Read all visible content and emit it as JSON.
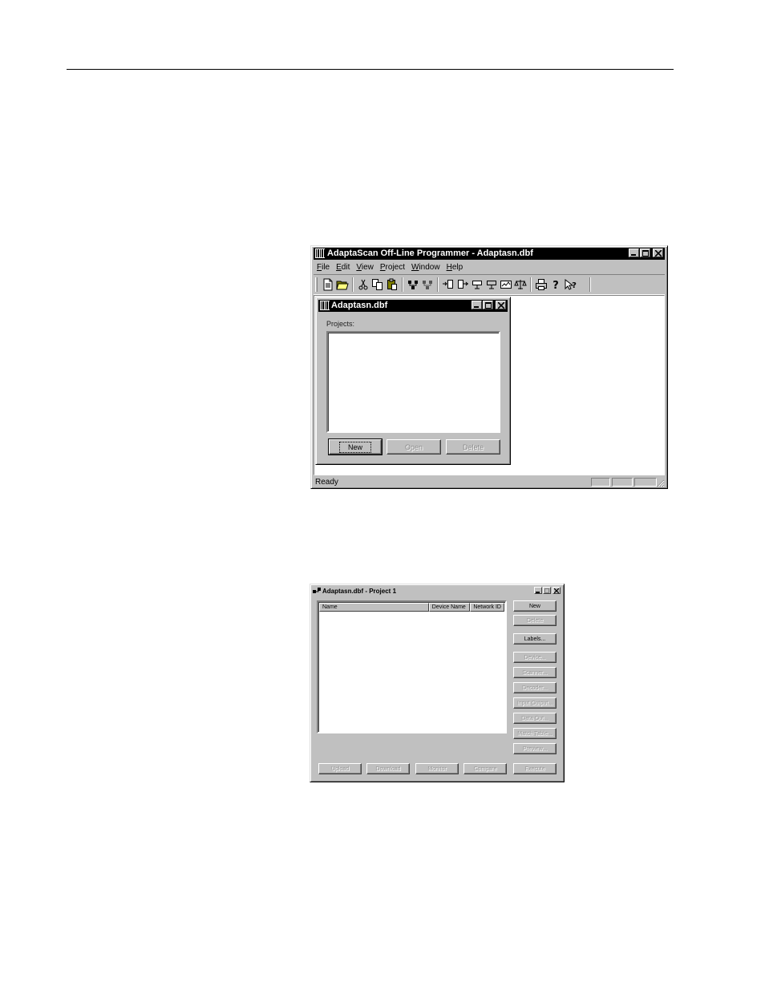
{
  "main_window": {
    "title": "AdaptaScan Off-Line Programmer - Adaptasn.dbf",
    "menu": [
      {
        "label": "File",
        "accel": "F",
        "rest": "ile"
      },
      {
        "label": "Edit",
        "accel": "E",
        "rest": "dit"
      },
      {
        "label": "View",
        "accel": "V",
        "rest": "iew"
      },
      {
        "label": "Project",
        "accel": "P",
        "rest": "roject"
      },
      {
        "label": "Window",
        "accel": "W",
        "rest": "indow"
      },
      {
        "label": "Help",
        "accel": "H",
        "rest": "elp"
      }
    ],
    "toolbar_icons": [
      "new-file-icon",
      "open-folder-icon",
      "cut-icon",
      "copy-icon",
      "paste-icon",
      "network-icon",
      "network-config-icon",
      "download-icon",
      "upload-icon",
      "device-icon",
      "device2-icon",
      "monitor-icon",
      "compare-icon",
      "print-icon",
      "help-icon",
      "context-help-icon"
    ],
    "status": "Ready"
  },
  "child_window": {
    "title": "Adaptasn.dbf",
    "projects_label": "Projects:",
    "buttons": {
      "new": "New",
      "open": "Open",
      "delete": "Delete"
    }
  },
  "project_dialog": {
    "title": "Adaptasn.dbf - Project 1",
    "columns": [
      "Name",
      "Device Name",
      "Network ID"
    ],
    "side_buttons": [
      {
        "label": "New",
        "enabled": true
      },
      {
        "label": "Delete",
        "enabled": false
      },
      {
        "label": "Labels...",
        "enabled": true
      },
      {
        "label": "Device...",
        "enabled": false
      },
      {
        "label": "Scanner...",
        "enabled": false
      },
      {
        "label": "Decoder...",
        "enabled": false
      },
      {
        "label": "Input Output...",
        "enabled": false
      },
      {
        "label": "Data Out...",
        "enabled": false
      },
      {
        "label": "Match Table...",
        "enabled": false
      },
      {
        "label": "Preview...",
        "enabled": false
      }
    ],
    "bottom_buttons": [
      {
        "label": "Upload",
        "enabled": false
      },
      {
        "label": "Download",
        "enabled": false
      },
      {
        "label": "Monitor",
        "enabled": false
      },
      {
        "label": "Compare",
        "enabled": false
      },
      {
        "label": "Execute",
        "enabled": false
      }
    ]
  }
}
